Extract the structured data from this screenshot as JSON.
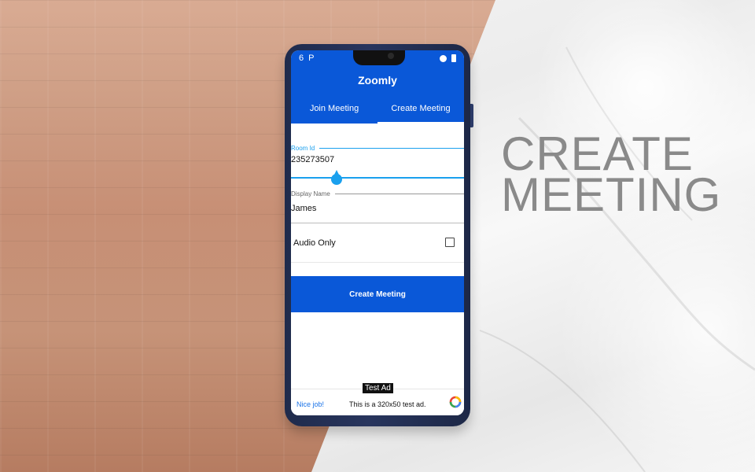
{
  "headline": {
    "line1": "CREATE",
    "line2": "MEETING"
  },
  "app": {
    "title": "Zoomly",
    "tabs": [
      {
        "label": "Join Meeting",
        "active": false
      },
      {
        "label": "Create Meeting",
        "active": true
      }
    ]
  },
  "form": {
    "room": {
      "label": "Room Id",
      "value": "235273507"
    },
    "display_name": {
      "label": "Display Name",
      "value": "James"
    },
    "audio_only": {
      "label": "Audio Only",
      "checked": false
    },
    "submit_label": "Create Meeting"
  },
  "ad": {
    "badge": "Test Ad",
    "left_text": "Nice job!",
    "center_text": "This is a 320x50 test ad."
  },
  "colors": {
    "brand_blue": "#0a58d8",
    "input_active": "#1aa0ee",
    "headline_gray": "#8a8a8a"
  }
}
